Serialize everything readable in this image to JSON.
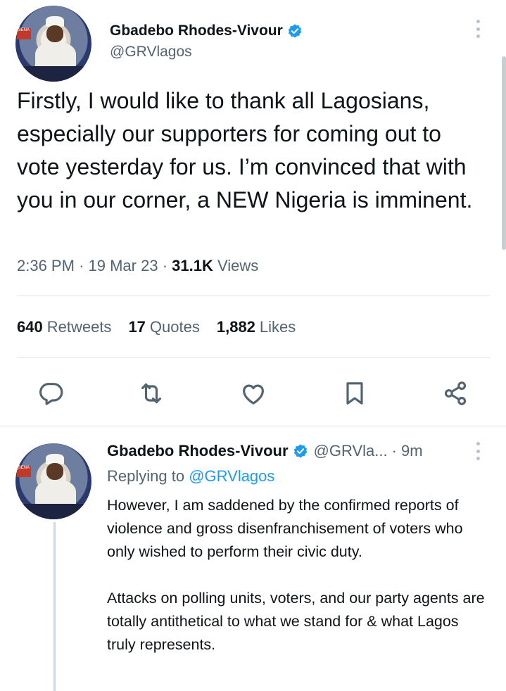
{
  "main_tweet": {
    "author_name": "Gbadebo Rhodes-Vivour",
    "handle": "@GRVlagos",
    "verified": true,
    "text": "Firstly, I would like to thank all Lagosians, especially our supporters for coming out to vote yesterday for us. I’m convinced that with you in our corner, a NEW Nigeria is imminent.",
    "time": "2:36 PM",
    "date": "19 Mar 23",
    "views_count": "31.1K",
    "views_label": "Views",
    "stats": {
      "retweets_count": "640",
      "retweets_label": "Retweets",
      "quotes_count": "17",
      "quotes_label": "Quotes",
      "likes_count": "1,882",
      "likes_label": "Likes"
    },
    "avatar_badge": "SENA"
  },
  "actions": [
    "reply-icon",
    "retweet-icon",
    "like-icon",
    "bookmark-icon",
    "share-icon"
  ],
  "reply_tweet": {
    "author_name": "Gbadebo Rhodes-Vivour",
    "handle": "@GRVla...",
    "time": "· 9m",
    "replying_prefix": "Replying to",
    "replying_to": "@GRVlagos",
    "text": "However, I am saddened by the confirmed reports of violence and gross disenfranchisement of voters who only wished to perform their civic duty.\n\nAttacks on polling units, voters, and our party agents are totally antithetical to what we stand for & what Lagos truly represents."
  },
  "colors": {
    "accent": "#1d9bf0",
    "text_primary": "#0f1419",
    "text_secondary": "#536471",
    "divider": "#dfe3e7"
  }
}
